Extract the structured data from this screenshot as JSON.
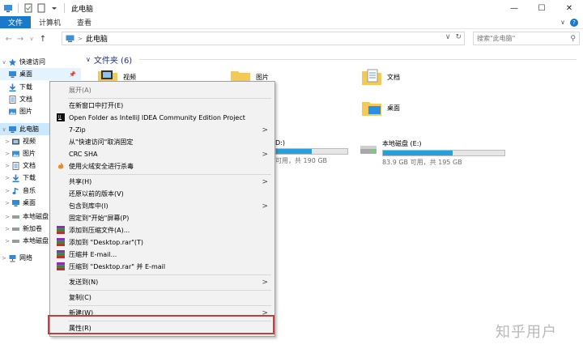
{
  "window": {
    "title": "此电脑",
    "controls": [
      "minimize-icon",
      "maximize-icon",
      "close-icon"
    ]
  },
  "ribbon": {
    "tabs": [
      "文件",
      "计算机",
      "查看"
    ],
    "active_tab": "文件",
    "colors": {
      "accent": "#1979ca"
    }
  },
  "address": {
    "path": "此电脑",
    "search_placeholder": "搜索\"此电脑\""
  },
  "navpane": {
    "items": [
      {
        "label": "快速访问",
        "icon": "star-icon"
      },
      {
        "label": "桌面",
        "icon": "desktop-icon"
      },
      {
        "label": "下载",
        "icon": "download-icon"
      },
      {
        "label": "文档",
        "icon": "document-icon"
      },
      {
        "label": "图片",
        "icon": "pictures-icon"
      },
      {
        "label": "此电脑",
        "icon": "computer-icon"
      },
      {
        "label": "视频",
        "icon": "video-icon"
      },
      {
        "label": "图片",
        "icon": "pictures-icon"
      },
      {
        "label": "文档",
        "icon": "document-icon"
      },
      {
        "label": "下载",
        "icon": "download-icon"
      },
      {
        "label": "音乐",
        "icon": "music-icon"
      },
      {
        "label": "桌面",
        "icon": "desktop-icon"
      },
      {
        "label": "本地磁盘",
        "icon": "drive-icon"
      },
      {
        "label": "新加卷",
        "icon": "drive-icon"
      },
      {
        "label": "本地磁盘",
        "icon": "drive-icon"
      },
      {
        "label": "网络",
        "icon": "network-icon"
      }
    ]
  },
  "content": {
    "section_title": "文件夹 (6)",
    "folders": [
      {
        "label": "视频",
        "icon": "video-folder-icon"
      },
      {
        "label": "图片",
        "icon": "pictures-folder-icon"
      },
      {
        "label": "文档",
        "icon": "documents-folder-icon"
      },
      {
        "label": "桌面",
        "icon": "desktop-folder-icon"
      }
    ],
    "drives": [
      {
        "label": "D:)",
        "sub": "可用，共 190 GB",
        "used_fraction": 0.5
      },
      {
        "label": "本地磁盘 (E:)",
        "sub": "83.9 GB 可用，共 195 GB",
        "used_fraction": 0.57
      }
    ]
  },
  "context_menu": {
    "items": [
      {
        "label": "展开(A)"
      },
      {
        "label": "在新窗口中打开(E)"
      },
      {
        "label": "Open Folder as IntelliJ IDEA Community Edition Project",
        "icon": "intellij-icon"
      },
      {
        "label": "7-Zip",
        "submenu": true
      },
      {
        "label": "从\"快速访问\"取消固定"
      },
      {
        "label": "CRC SHA",
        "submenu": true
      },
      {
        "label": "使用火绒安全进行杀毒",
        "icon": "huorong-icon"
      },
      {
        "label": "共享(H)",
        "submenu": true
      },
      {
        "label": "还原以前的版本(V)"
      },
      {
        "label": "包含到库中(I)",
        "submenu": true
      },
      {
        "label": "固定到\"开始\"屏幕(P)"
      },
      {
        "label": "添加到压缩文件(A)...",
        "icon": "winrar-icon"
      },
      {
        "label": "添加到 \"Desktop.rar\"(T)",
        "icon": "winrar-icon"
      },
      {
        "label": "压缩并 E-mail...",
        "icon": "winrar-icon"
      },
      {
        "label": "压缩到 \"Desktop.rar\" 并 E-mail",
        "icon": "winrar-icon"
      },
      {
        "label": "发送到(N)",
        "submenu": true
      },
      {
        "label": "复制(C)"
      },
      {
        "label": "新建(W)",
        "submenu": true
      },
      {
        "label": "属性(R)"
      }
    ],
    "highlight_color": "#c0403c"
  },
  "watermark": "知乎用户"
}
